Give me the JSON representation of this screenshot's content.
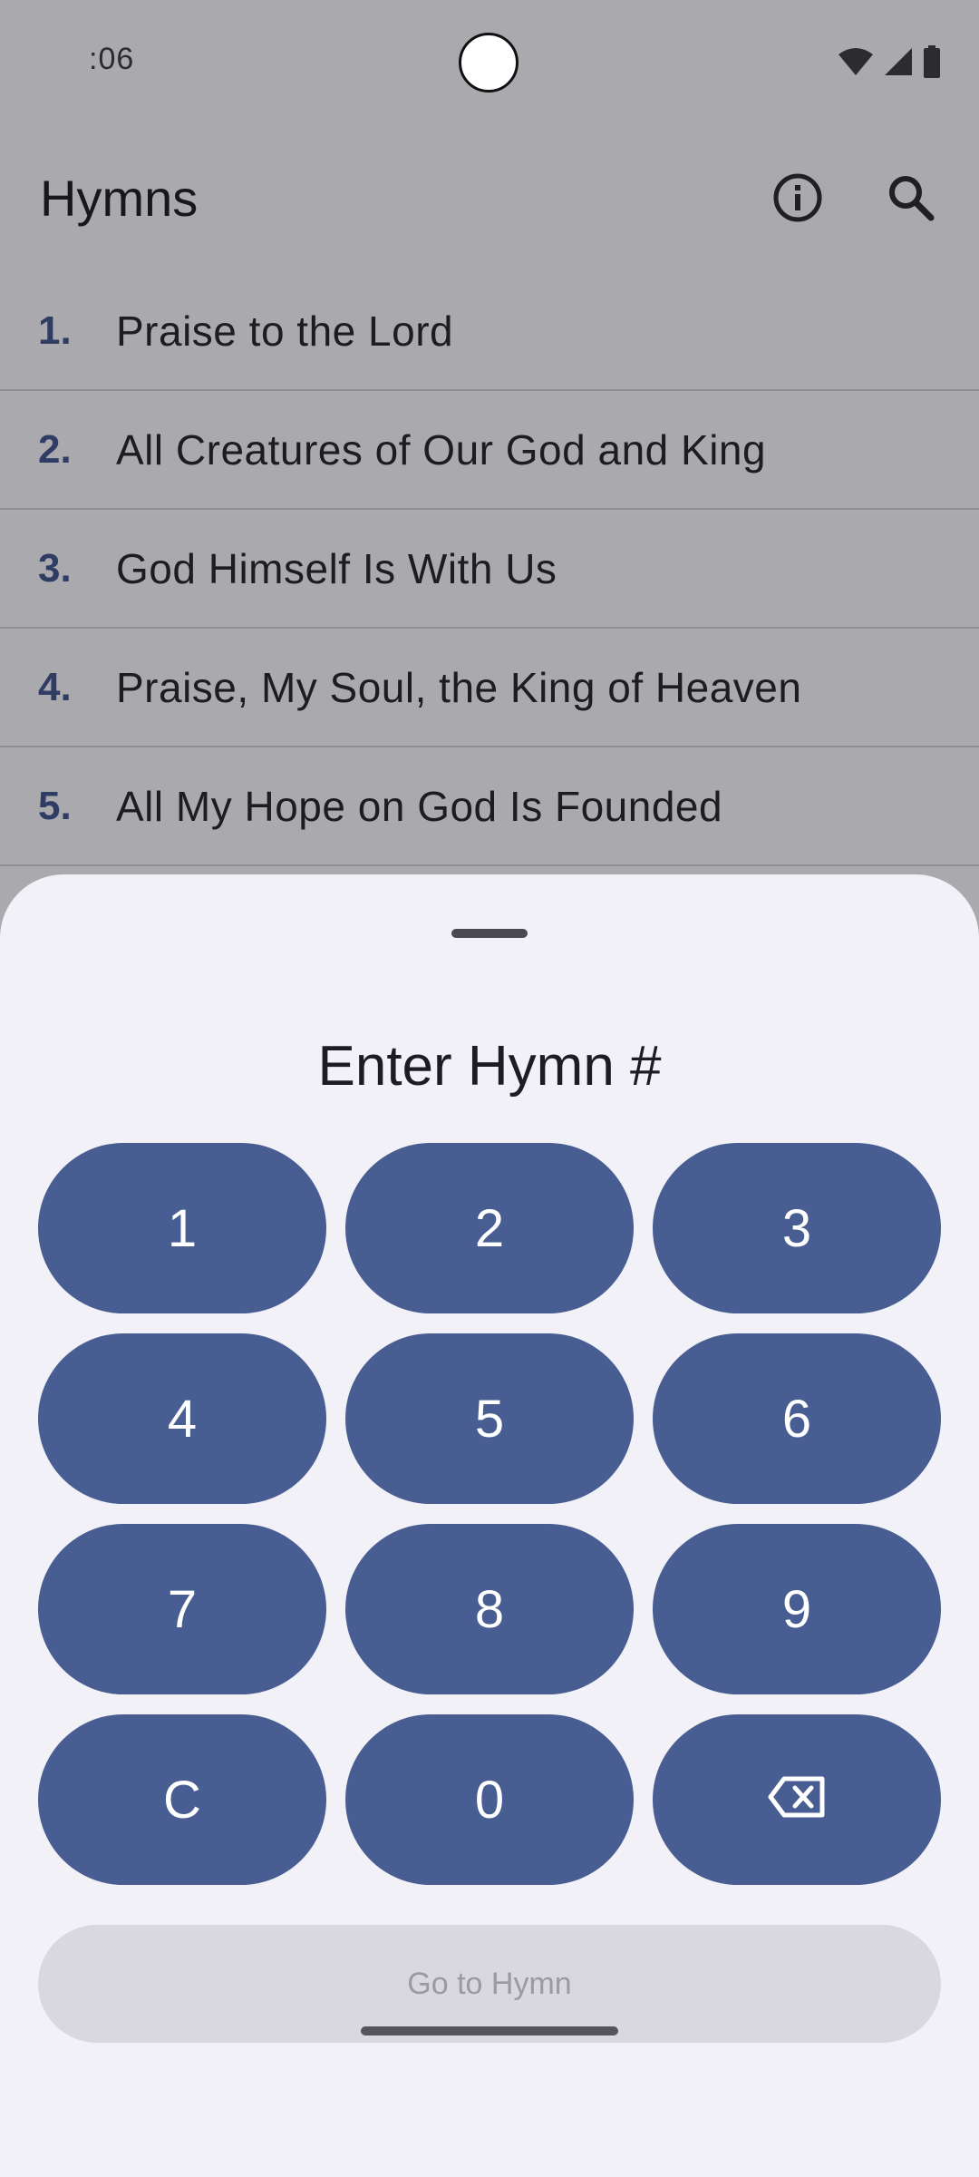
{
  "status_bar": {
    "time": ":06"
  },
  "app_bar": {
    "title": "Hymns"
  },
  "hymns": [
    {
      "number": "1.",
      "title": "Praise to the Lord"
    },
    {
      "number": "2.",
      "title": "All Creatures of Our God and King"
    },
    {
      "number": "3.",
      "title": "God Himself Is With Us"
    },
    {
      "number": "4.",
      "title": "Praise, My Soul, the King of Heaven"
    },
    {
      "number": "5.",
      "title": "All My Hope on God Is Founded"
    }
  ],
  "sheet": {
    "title": "Enter Hymn #",
    "keys": [
      "1",
      "2",
      "3",
      "4",
      "5",
      "6",
      "7",
      "8",
      "9",
      "C",
      "0"
    ],
    "go_label": "Go to Hymn"
  },
  "colors": {
    "scrim": "#aaa9ad",
    "key": "#485e92",
    "hymn_number": "#2f3d64",
    "sheet_bg": "#f2f1f7"
  }
}
